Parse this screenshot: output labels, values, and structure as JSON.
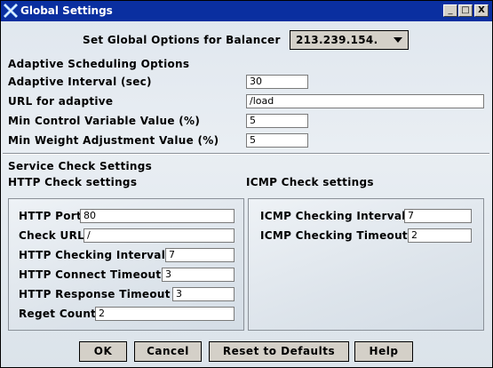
{
  "window": {
    "title": "Global Settings",
    "minimize_glyph": "_",
    "maximize_glyph": "□",
    "close_glyph": "X"
  },
  "balancer": {
    "label": "Set Global Options for Balancer",
    "selected": "213.239.154."
  },
  "adaptive": {
    "heading": "Adaptive Scheduling Options",
    "interval_label": "Adaptive Interval (sec)",
    "interval_value": "30",
    "url_label": "URL for adaptive",
    "url_value": "/load",
    "min_control_label": "Min Control Variable Value (%)",
    "min_control_value": "5",
    "min_weight_label": "Min Weight Adjustment Value (%)",
    "min_weight_value": "5"
  },
  "service": {
    "heading": "Service Check Settings"
  },
  "http": {
    "heading": "HTTP Check settings",
    "port_label": "HTTP Port",
    "port_value": "80",
    "url_label": "Check URL",
    "url_value": "/",
    "interval_label": "HTTP Checking Interval",
    "interval_value": "7",
    "connect_label": "HTTP Connect Timeout",
    "connect_value": "3",
    "response_label": "HTTP Response Timeout",
    "response_value": "3",
    "reget_label": "Reget Count",
    "reget_value": "2"
  },
  "icmp": {
    "heading": "ICMP Check settings",
    "interval_label": "ICMP Checking Interval",
    "interval_value": "7",
    "timeout_label": "ICMP Checking Timeout",
    "timeout_value": "2"
  },
  "buttons": {
    "ok": "OK",
    "cancel": "Cancel",
    "reset": "Reset to Defaults",
    "help": "Help"
  },
  "colors": {
    "titlebar": "#0a2fa0",
    "window_bg": "#dfe6ee",
    "button_face": "#d4d0c8"
  }
}
